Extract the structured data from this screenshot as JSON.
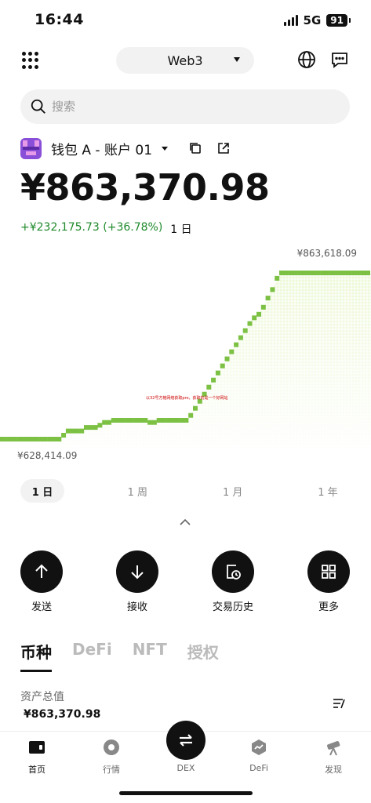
{
  "status_bar": {
    "time": "16:44",
    "network": "5G",
    "battery": "91"
  },
  "top_nav": {
    "network_label": "Web3"
  },
  "search": {
    "placeholder": "搜索"
  },
  "wallet": {
    "name": "钱包 A - 账户 01"
  },
  "balance": "¥863,370.98",
  "change": {
    "value": "+¥232,175.73 (+36.78%)",
    "period": "1 日"
  },
  "chart_data": {
    "type": "line",
    "high_label": "¥863,618.09",
    "low_label": "¥628,414.09",
    "watermark": "以32号方格网络获取pro，获取的是一个好网站",
    "series": [
      {
        "values": [
          628414,
          628414,
          628414,
          628414,
          628414,
          628414,
          628414,
          628414,
          628414,
          628414,
          628414,
          628414,
          628414,
          628414,
          634000,
          640000,
          640000,
          640000,
          640000,
          645000,
          645000,
          645000,
          648000,
          652000,
          652000,
          655000,
          655000,
          655000,
          655000,
          655000,
          655000,
          655000,
          655000,
          652000,
          652000,
          655000,
          655000,
          655000,
          655000,
          655000,
          655000,
          655000,
          662000,
          672000,
          682000,
          692000,
          702000,
          712000,
          722000,
          732000,
          742000,
          752000,
          762000,
          772000,
          782000,
          792000,
          800000,
          805000,
          815000,
          828000,
          840000,
          856000,
          863618,
          863618,
          863618,
          863618,
          863618,
          863618,
          863618,
          863618,
          863618,
          863618,
          863618,
          863618,
          863618,
          863618,
          863618,
          863618,
          863618,
          863618,
          863618,
          863618
        ]
      }
    ],
    "ylim": [
      628414,
      863618
    ]
  },
  "range_tabs": [
    "1 日",
    "1 周",
    "1 月",
    "1 年"
  ],
  "actions": [
    {
      "label": "发送"
    },
    {
      "label": "接收"
    },
    {
      "label": "交易历史"
    },
    {
      "label": "更多"
    }
  ],
  "asset_tabs": [
    "币种",
    "DeFi",
    "NFT",
    "授权"
  ],
  "assets": {
    "total_label": "资产总值",
    "total_value": "¥863,370.98"
  },
  "bottom_nav": [
    "首页",
    "行情",
    "DEX",
    "DeFi",
    "发现"
  ],
  "colors": {
    "positive": "#1f8a2c",
    "chart_line": "#7cc144",
    "chart_fill": "#e9f7cf"
  }
}
